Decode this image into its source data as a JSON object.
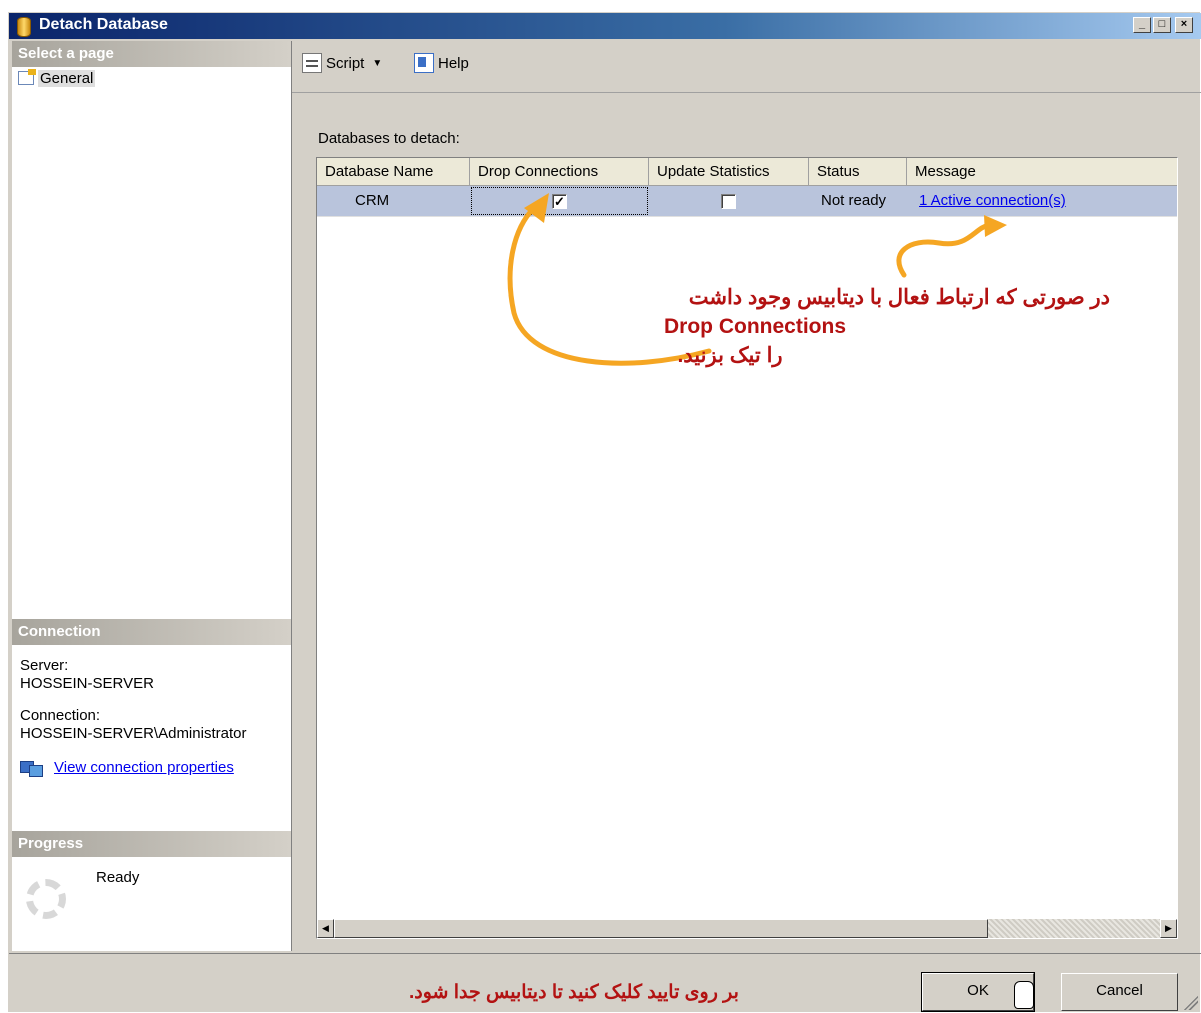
{
  "window": {
    "title": "Detach Database",
    "min": "_",
    "max": "□",
    "close": "×"
  },
  "left": {
    "select_page_header": "Select a page",
    "pages": [
      {
        "label": "General"
      }
    ],
    "connection": {
      "header": "Connection",
      "server_label": "Server:",
      "server_value": "HOSSEIN-SERVER",
      "connection_label": "Connection:",
      "connection_value": "HOSSEIN-SERVER\\Administrator",
      "view_link": "View connection properties"
    },
    "progress": {
      "header": "Progress",
      "status": "Ready"
    }
  },
  "toolbar": {
    "script_label": "Script",
    "help_label": "Help"
  },
  "grid": {
    "label": "Databases to detach:",
    "columns": [
      "Database Name",
      "Drop Connections",
      "Update Statistics",
      "Status",
      "Message"
    ],
    "rows": [
      {
        "name": "CRM",
        "drop_connections": true,
        "update_statistics": false,
        "status": "Not ready",
        "message": "1 Active connection(s)"
      }
    ]
  },
  "annotation": {
    "line1": "در صورتی که ارتباط فعال با دیتابیس وجود داشت",
    "line2": "Drop Connections",
    "line3": "را تیک بزنید."
  },
  "footer": {
    "hint": "بر روی تایید کلیک کنید تا دیتابیس جدا شود.",
    "ok": "OK",
    "cancel": "Cancel"
  },
  "colors": {
    "annotation": "#b31212",
    "arrow": "#f5a623",
    "row_highlight": "#b9c4dc"
  },
  "icons": [
    "database-icon",
    "page-icon",
    "connection-icon",
    "spinner-icon",
    "script-icon",
    "help-icon",
    "cursor-hand-icon"
  ]
}
